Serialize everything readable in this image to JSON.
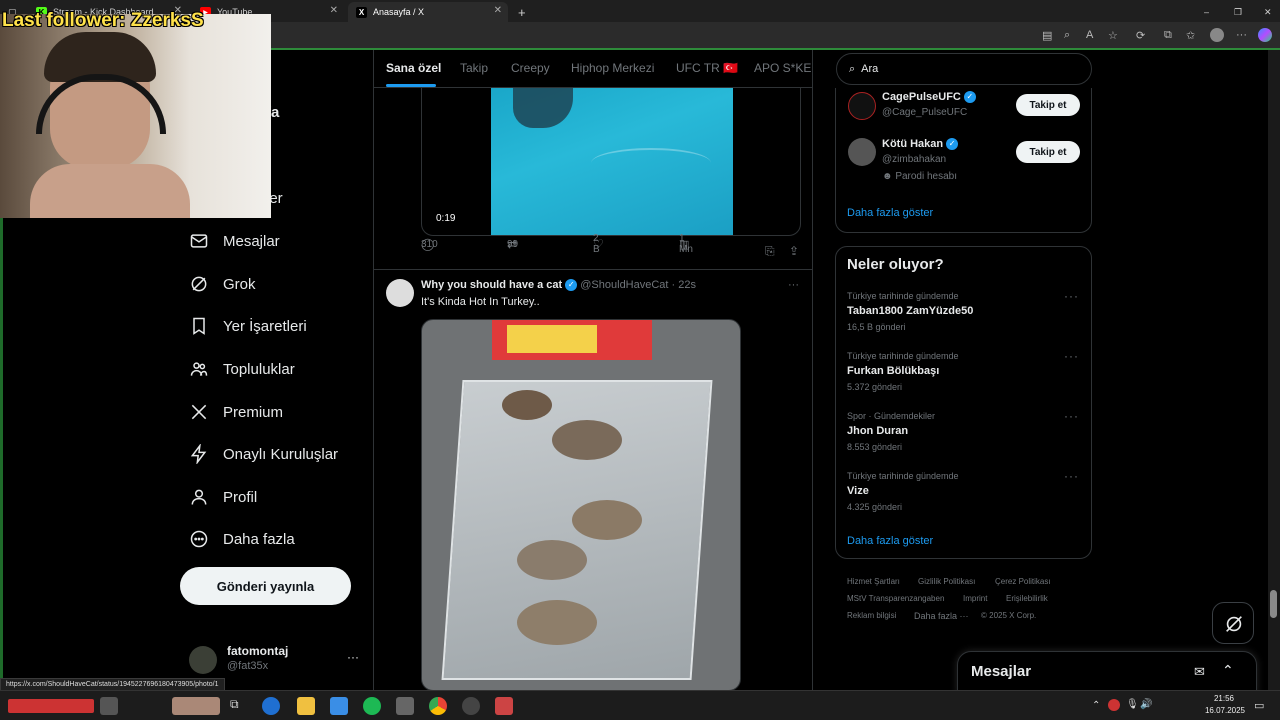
{
  "browser": {
    "tabs": [
      {
        "label": "Stream - Kick Dashboard",
        "fav": "K"
      },
      {
        "label": "YouTube",
        "fav": "▶"
      },
      {
        "label": "Anasayfa / X",
        "fav": "X"
      }
    ],
    "new_tab": "+",
    "window_controls": {
      "minimize": "–",
      "restore": "❐",
      "close": "✕"
    }
  },
  "overlay": {
    "last_follower": "Last follower: ZzerksS"
  },
  "nav": {
    "partial_home": "fa",
    "partial_lists": "ler",
    "items": [
      {
        "label": "Mesajlar",
        "icon": "mail-icon"
      },
      {
        "label": "Grok",
        "icon": "grok-icon"
      },
      {
        "label": "Yer İşaretleri",
        "icon": "bookmark-icon"
      },
      {
        "label": "Topluluklar",
        "icon": "communities-icon"
      },
      {
        "label": "Premium",
        "icon": "x-logo-icon"
      },
      {
        "label": "Onaylı Kuruluşlar",
        "icon": "lightning-icon"
      },
      {
        "label": "Profil",
        "icon": "person-icon"
      },
      {
        "label": "Daha fazla",
        "icon": "more-circle-icon"
      }
    ],
    "post_button": "Gönderi yayınla",
    "account": {
      "name": "fatomontaj",
      "handle": "@fat35x",
      "more": "···"
    }
  },
  "feed": {
    "tabs": [
      "Sana özel",
      "Takip",
      "Creepy",
      "Hiphop Merkezi",
      "UFC TR 🇹🇷",
      "APO S*KEN"
    ],
    "video": {
      "duration": "0:19"
    },
    "video_actions": {
      "replies": "310",
      "reposts": "99",
      "likes": "2 B",
      "views": "1 Mn"
    },
    "tweet": {
      "name": "Why you should have a cat",
      "handle": "@ShouldHaveCat",
      "time": "22s",
      "sep": "·",
      "text": "It's Kinda Hot In Turkey..",
      "more": "···"
    }
  },
  "right": {
    "search_placeholder": "Ara",
    "who_to_follow": [
      {
        "name": "CagePulseUFC",
        "handle": "@Cage_PulseUFC",
        "button": "Takip et"
      },
      {
        "name": "Kötü Hakan",
        "handle": "@zimbahakan",
        "note": "Parodi hesabı",
        "button": "Takip et"
      }
    ],
    "show_more_1": "Daha fazla göster",
    "trends_title": "Neler oluyor?",
    "trends": [
      {
        "context": "Türkiye tarihinde gündemde",
        "name": "Taban1800 ZamYüzde50",
        "count": "16,5 B gönderi"
      },
      {
        "context": "Türkiye tarihinde gündemde",
        "name": "Furkan Bölükbaşı",
        "count": "5.372 gönderi"
      },
      {
        "context": "Spor · Gündemdekiler",
        "name": "Jhon Duran",
        "count": "8.553 gönderi"
      },
      {
        "context": "Türkiye tarihinde gündemde",
        "name": "Vize",
        "count": "4.325 gönderi"
      }
    ],
    "show_more_2": "Daha fazla göster",
    "footer": [
      "Hizmet Şartları",
      "Gizlilik Politikası",
      "Çerez Politikası",
      "MStV Transparenzangaben",
      "Imprint",
      "Erişilebilirlik",
      "Reklam bilgisi",
      "Daha fazla ···",
      "© 2025 X Corp."
    ],
    "messages_dock": "Mesajlar"
  },
  "status_url": "https://x.com/ShouldHaveCat/status/1945227696180473905/photo/1",
  "taskbar": {
    "time": "21:56",
    "date": "16.07.2025"
  },
  "colors": {
    "accent": "#1d9bf0",
    "edge_green": "#2e8b3a",
    "follower_text": "#ffe24a"
  }
}
